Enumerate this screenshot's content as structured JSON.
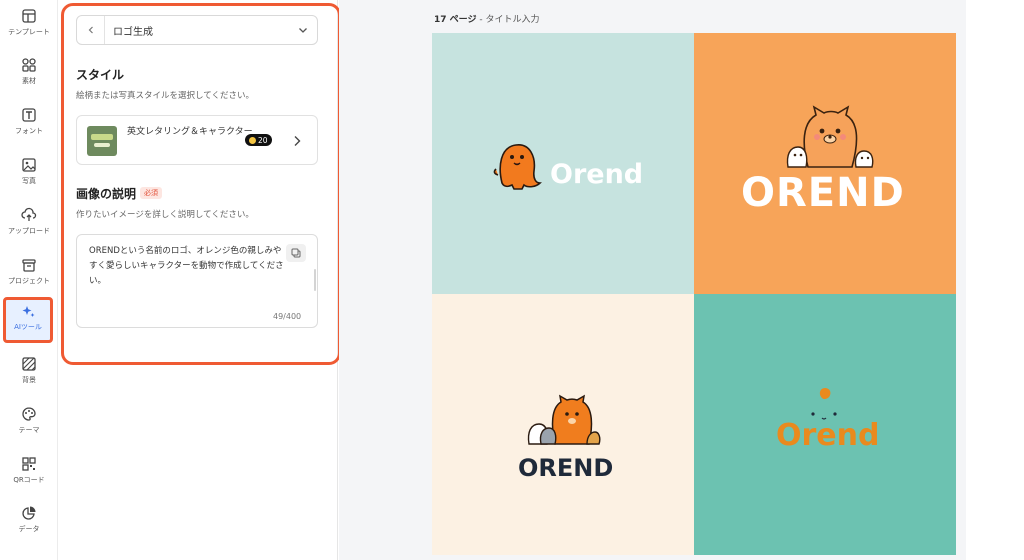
{
  "sidebar": {
    "items": [
      {
        "label": "テンプレート",
        "icon": "template-icon"
      },
      {
        "label": "素材",
        "icon": "elements-icon"
      },
      {
        "label": "フォント",
        "icon": "font-icon"
      },
      {
        "label": "写真",
        "icon": "photo-icon"
      },
      {
        "label": "アップロード",
        "icon": "upload-icon"
      },
      {
        "label": "プロジェクト",
        "icon": "project-icon"
      },
      {
        "label": "AIツール",
        "icon": "ai-tools-icon",
        "active": true
      },
      {
        "label": "背景",
        "icon": "background-icon"
      },
      {
        "label": "テーマ",
        "icon": "theme-icon"
      },
      {
        "label": "QRコード",
        "icon": "qr-code-icon"
      },
      {
        "label": "データ",
        "icon": "data-chart-icon"
      }
    ]
  },
  "panel": {
    "dropdown_label": "ロゴ生成",
    "style_section": {
      "title": "スタイル",
      "subtitle": "絵柄または写真スタイルを選択してください。",
      "selected_style": "英文レタリング＆キャラクター",
      "credit": "20"
    },
    "description_section": {
      "title": "画像の説明",
      "required_badge": "必須",
      "subtitle": "作りたいイメージを詳しく説明してください。",
      "text": "ORENDという名前のロゴ、オレンジ色の親しみやすく愛らしいキャラクターを動物で作成してください。",
      "counter": "49/400"
    }
  },
  "canvas": {
    "page_number": "17 ページ",
    "page_title": "- タイトル入力",
    "logos": [
      {
        "text": "Orend",
        "bg": "#c6e3df",
        "color": "#ffffff"
      },
      {
        "text": "OREND",
        "bg": "#f7a459",
        "color": "#ffffff"
      },
      {
        "text": "OREND",
        "bg": "#fcf1e3",
        "color": "#1f2a3a"
      },
      {
        "text": "Orend",
        "bg": "#6cc2b1",
        "color": "#e98a1e"
      }
    ]
  },
  "colors": {
    "highlight": "#ef5a33",
    "accent_blue": "#3b6fe0",
    "brand_orange": "#f58220"
  }
}
